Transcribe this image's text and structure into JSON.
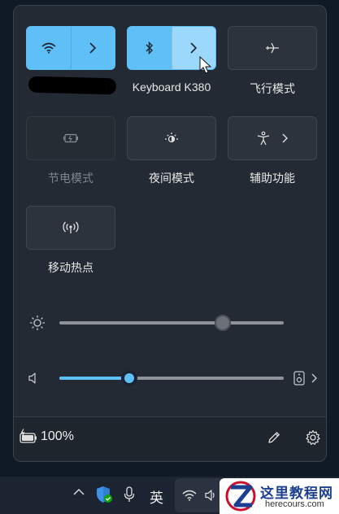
{
  "quick_settings": {
    "tiles": {
      "wifi": {
        "label": "",
        "icon": "wifi-icon",
        "state": "on"
      },
      "bluetooth": {
        "label": "Keyboard K380",
        "icon": "bluetooth-icon",
        "state": "on"
      },
      "airplane": {
        "label": "飞行模式",
        "icon": "airplane-icon",
        "state": "off"
      },
      "battery_saver": {
        "label": "节电模式",
        "icon": "battery-saver-icon",
        "state": "disabled"
      },
      "night_light": {
        "label": "夜间模式",
        "icon": "night-light-icon",
        "state": "off"
      },
      "accessibility": {
        "label": "辅助功能",
        "icon": "accessibility-icon",
        "state": "off"
      },
      "hotspot": {
        "label": "移动热点",
        "icon": "hotspot-icon",
        "state": "off"
      }
    },
    "brightness": {
      "icon": "brightness-icon",
      "level": 0.73
    },
    "volume": {
      "icon": "speaker-icon",
      "level": 0.31,
      "output_icon": "speaker-device-icon"
    },
    "footer": {
      "battery_percent": "100%",
      "edit_icon": "pencil-icon",
      "settings_icon": "gear-icon"
    }
  },
  "taskbar": {
    "ime_label": "英",
    "icons": [
      "chevron-up-icon",
      "security-shield-icon",
      "microphone-icon",
      "wifi-icon",
      "speaker-icon"
    ]
  },
  "watermark": {
    "title": "这里教程网",
    "url": "herecours.com"
  },
  "colors": {
    "accent": "#5ec0f7",
    "panel": "#232a33",
    "tile": "#2d333d"
  }
}
